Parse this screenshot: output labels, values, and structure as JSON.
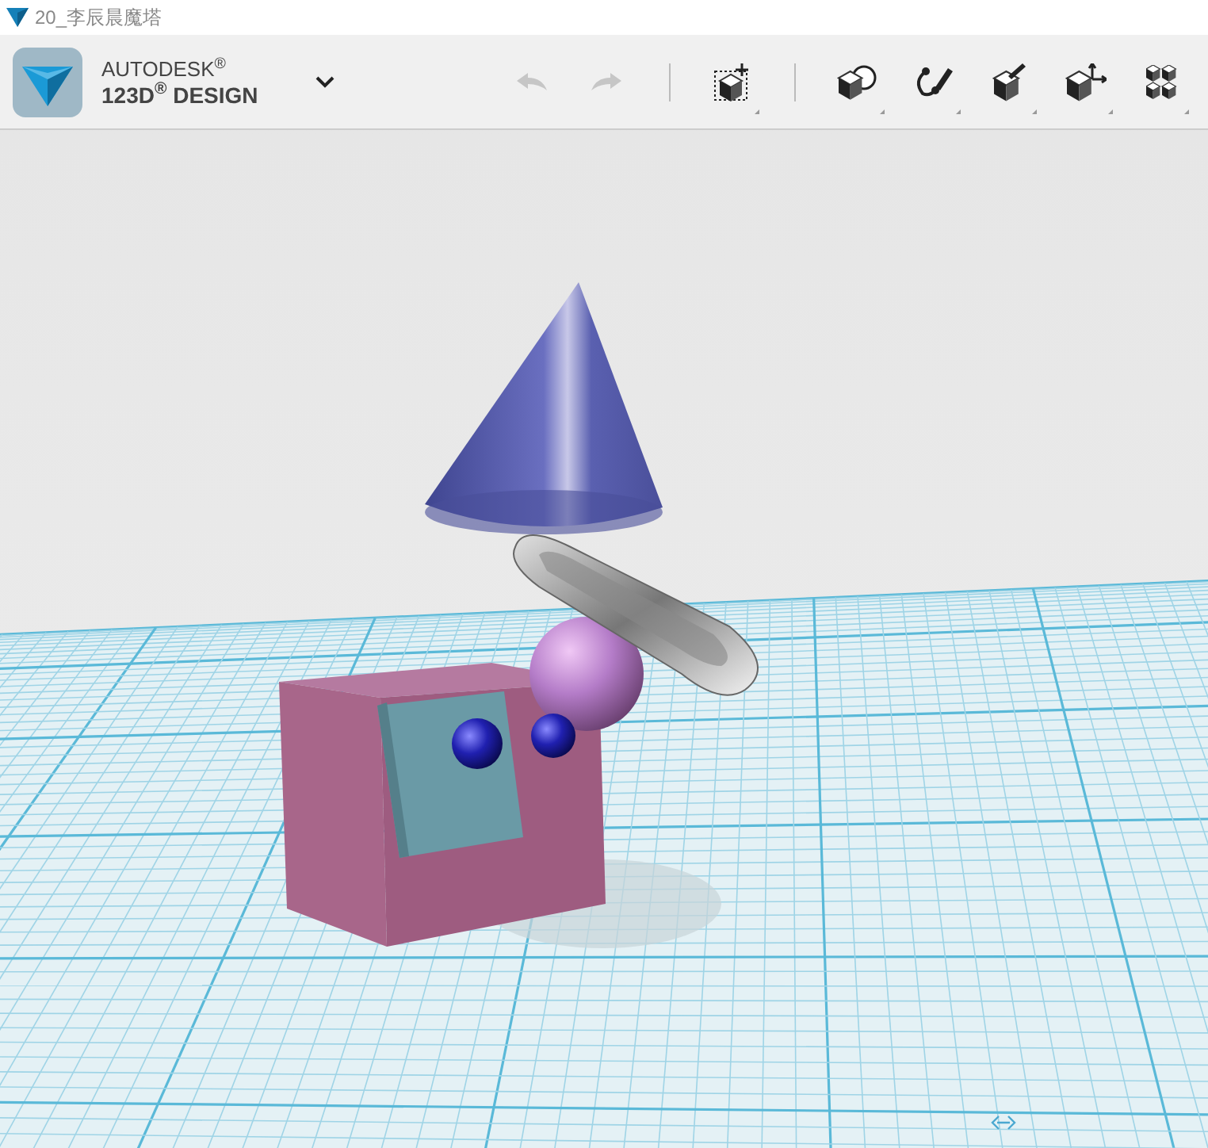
{
  "window": {
    "title": "20_李辰晨魔塔"
  },
  "brand": {
    "line_1": "AUTODESK$^{®}$",
    "line_2": "123D$^{®}$ DESIGN"
  },
  "toolbar": [
    {
      "kind": "undo",
      "disabled": true
    },
    {
      "kind": "redo",
      "disabled": true
    },
    {
      "kind": "divider"
    },
    {
      "kind": "transform",
      "disabled": false
    },
    {
      "kind": "divider"
    },
    {
      "kind": "primitives",
      "disabled": false
    },
    {
      "kind": "sketch",
      "disabled": false
    },
    {
      "kind": "construct",
      "disabled": false
    },
    {
      "kind": "modify",
      "disabled": false
    },
    {
      "kind": "pattern",
      "disabled": false
    }
  ]
}
